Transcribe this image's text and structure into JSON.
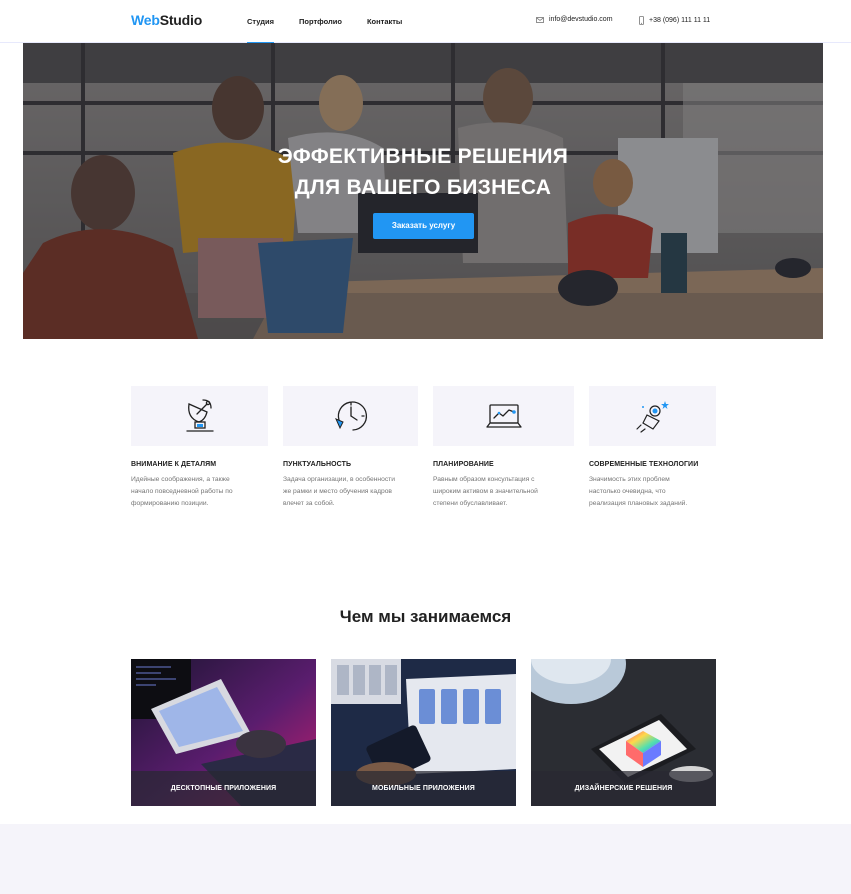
{
  "header": {
    "logo_part1": "Web",
    "logo_part2": "Studio",
    "nav": [
      {
        "label": "Студия"
      },
      {
        "label": "Портфолио"
      },
      {
        "label": "Контакты"
      }
    ],
    "email": "info@devstudio.com",
    "phone": "+38 (096) 111 11 11"
  },
  "hero": {
    "title_line1": "ЭФФЕКТИВНЫЕ РЕШЕНИЯ",
    "title_line2": "ДЛЯ ВАШЕГО БИЗНЕСА",
    "cta": "Заказать услугу"
  },
  "features": [
    {
      "icon": "satellite-dish-icon",
      "title": "ВНИМАНИЕ К ДЕТАЛЯМ",
      "text": [
        "Идейные соображения, а также",
        "начало повседневной работы по",
        "формированию позиции."
      ]
    },
    {
      "icon": "clock-icon",
      "title": "ПУНКТУАЛЬНОСТЬ",
      "text": [
        "Задача организации, в особенности",
        "же рамки и место обучения кадров",
        "влечет за собой."
      ]
    },
    {
      "icon": "laptop-chart-icon",
      "title": "ПЛАНИРОВАНИЕ",
      "text": [
        "Равным образом консультация с",
        "широким активом в значительной",
        "степени обуславливает."
      ]
    },
    {
      "icon": "astronaut-icon",
      "title": "СОВРЕМЕННЫЕ ТЕХНОЛОГИИ",
      "text": [
        "Значимость этих проблем",
        "настолько очевидна, что",
        "реализация плановых заданий."
      ]
    }
  ],
  "services": {
    "title": "Чем мы занимаемся",
    "items": [
      {
        "label": "ДЕСКТОПНЫЕ ПРИЛОЖЕНИЯ"
      },
      {
        "label": "МОБИЛЬНЫЕ ПРИЛОЖЕНИЯ"
      },
      {
        "label": "ДИЗАЙНЕРСКИЕ РЕШЕНИЯ"
      }
    ]
  },
  "colors": {
    "accent": "#2196f3",
    "text": "#212121",
    "muted": "#757575",
    "tile_bg": "#f5f4fa"
  }
}
